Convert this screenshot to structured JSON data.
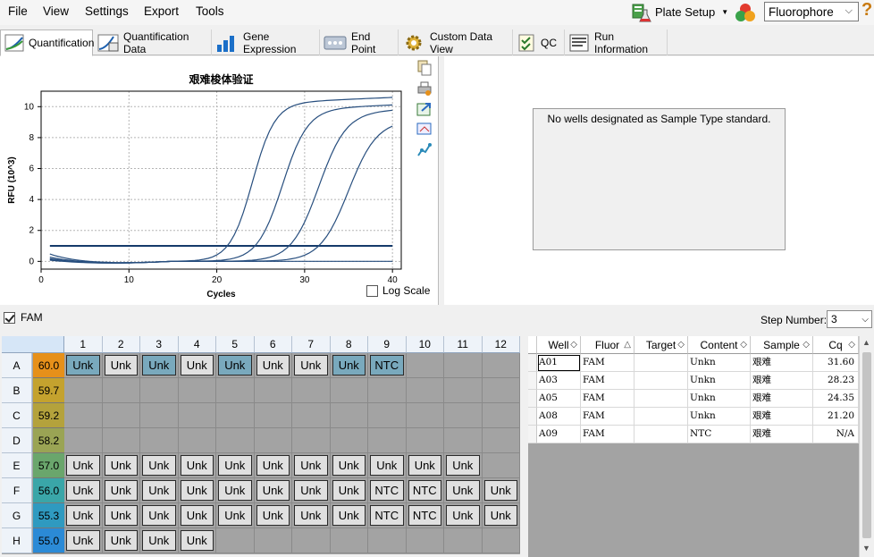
{
  "menu": [
    "File",
    "View",
    "Settings",
    "Export",
    "Tools"
  ],
  "toolbar": {
    "plate_setup": "Plate Setup",
    "fluorophore": "Fluorophore",
    "help": "?"
  },
  "tabs": [
    "Quantification",
    "Quantification Data",
    "Gene Expression",
    "End Point",
    "Custom Data View",
    "QC",
    "Run Information"
  ],
  "chart_data": {
    "type": "line",
    "title": "艰难梭体验证",
    "xlabel": "Cycles",
    "ylabel": "RFU (10^3)",
    "xlim": [
      0,
      41
    ],
    "ylim": [
      -0.5,
      11
    ],
    "xticks": [
      0,
      10,
      20,
      30,
      40
    ],
    "yticks": [
      0,
      2,
      4,
      6,
      8,
      10
    ],
    "threshold": 1.0,
    "grid": true,
    "series": [
      {
        "well": "A01",
        "cq": 31.6,
        "plateau": 9.0,
        "k": 0.62,
        "baseline_start": 0.5
      },
      {
        "well": "A03",
        "cq": 28.23,
        "plateau": 9.6,
        "k": 0.64,
        "baseline_start": 0.3
      },
      {
        "well": "A05",
        "cq": 24.35,
        "plateau": 9.8,
        "k": 0.7,
        "baseline_start": 0.15
      },
      {
        "well": "A08",
        "cq": 21.2,
        "plateau": 10.2,
        "k": 0.78,
        "baseline_start": 0.2
      },
      {
        "well": "A09",
        "cq": null,
        "plateau": 0,
        "k": 0,
        "baseline_start": 0.1
      }
    ]
  },
  "log_scale_label": "Log Scale",
  "std_message": "No wells designated as Sample Type standard.",
  "fam_label": "FAM",
  "step": {
    "label": "Step Number:",
    "value": "3"
  },
  "plate": {
    "columns": [
      "1",
      "2",
      "3",
      "4",
      "5",
      "6",
      "7",
      "8",
      "9",
      "10",
      "11",
      "12"
    ],
    "rows": [
      {
        "label": "A",
        "temp": "60.0",
        "temp_color": "#e6901a",
        "wells": [
          "Unk*",
          "Unk",
          "Unk*",
          "Unk",
          "Unk*",
          "Unk",
          "Unk",
          "Unk*",
          "NTC*",
          "",
          "",
          ""
        ]
      },
      {
        "label": "B",
        "temp": "59.7",
        "temp_color": "#c4a22e",
        "wells": [
          "",
          "",
          "",
          "",
          "",
          "",
          "",
          "",
          "",
          "",
          "",
          ""
        ]
      },
      {
        "label": "C",
        "temp": "59.2",
        "temp_color": "#b4a23c",
        "wells": [
          "",
          "",
          "",
          "",
          "",
          "",
          "",
          "",
          "",
          "",
          "",
          ""
        ]
      },
      {
        "label": "D",
        "temp": "58.2",
        "temp_color": "#9aa454",
        "wells": [
          "",
          "",
          "",
          "",
          "",
          "",
          "",
          "",
          "",
          "",
          "",
          ""
        ]
      },
      {
        "label": "E",
        "temp": "57.0",
        "temp_color": "#6aa66c",
        "wells": [
          "Unk",
          "Unk",
          "Unk",
          "Unk",
          "Unk",
          "Unk",
          "Unk",
          "Unk",
          "Unk",
          "Unk",
          "Unk",
          ""
        ]
      },
      {
        "label": "F",
        "temp": "56.0",
        "temp_color": "#3aa6a8",
        "wells": [
          "Unk",
          "Unk",
          "Unk",
          "Unk",
          "Unk",
          "Unk",
          "Unk",
          "Unk",
          "NTC",
          "NTC",
          "Unk",
          "Unk"
        ]
      },
      {
        "label": "G",
        "temp": "55.3",
        "temp_color": "#2f9ac0",
        "wells": [
          "Unk",
          "Unk",
          "Unk",
          "Unk",
          "Unk",
          "Unk",
          "Unk",
          "Unk",
          "NTC",
          "NTC",
          "Unk",
          "Unk"
        ]
      },
      {
        "label": "H",
        "temp": "55.0",
        "temp_color": "#2b8ad6",
        "wells": [
          "Unk",
          "Unk",
          "Unk",
          "Unk",
          "",
          "",
          "",
          "",
          "",
          "",
          "",
          ""
        ]
      }
    ]
  },
  "table": {
    "headers": [
      "Well",
      "Fluor",
      "Target",
      "Content",
      "Sample",
      "Cq"
    ],
    "rows": [
      [
        "A01",
        "FAM",
        "",
        "Unkn",
        "艰难",
        "31.60"
      ],
      [
        "A03",
        "FAM",
        "",
        "Unkn",
        "艰难",
        "28.23"
      ],
      [
        "A05",
        "FAM",
        "",
        "Unkn",
        "艰难",
        "24.35"
      ],
      [
        "A08",
        "FAM",
        "",
        "Unkn",
        "艰难",
        "21.20"
      ],
      [
        "A09",
        "FAM",
        "",
        "NTC",
        "艰难",
        "N/A"
      ]
    ]
  }
}
